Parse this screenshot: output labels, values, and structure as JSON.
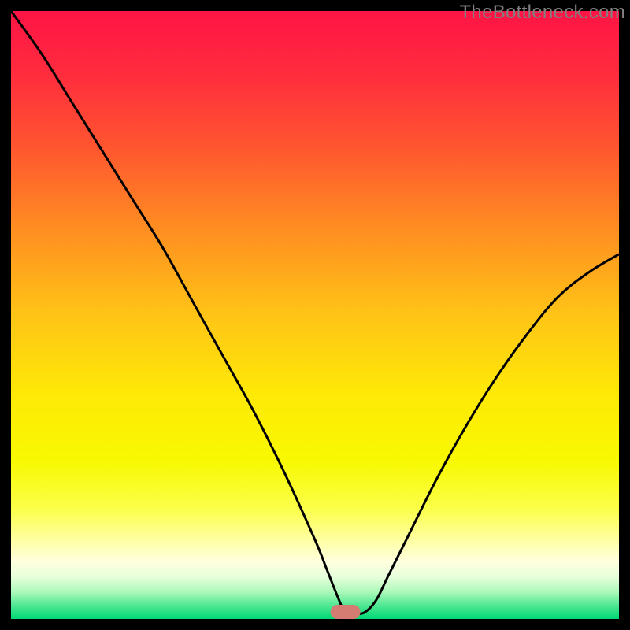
{
  "watermark": "TheBottleneck.com",
  "chart_data": {
    "type": "line",
    "title": "",
    "xlabel": "",
    "ylabel": "",
    "xlim": [
      0,
      100
    ],
    "ylim": [
      0,
      100
    ],
    "grid": false,
    "legend": false,
    "background": {
      "type": "vertical-gradient",
      "stops": [
        {
          "offset": 0.0,
          "color": "#ff1445"
        },
        {
          "offset": 0.1,
          "color": "#ff2b3e"
        },
        {
          "offset": 0.22,
          "color": "#ff5430"
        },
        {
          "offset": 0.35,
          "color": "#ff8a22"
        },
        {
          "offset": 0.5,
          "color": "#ffc416"
        },
        {
          "offset": 0.63,
          "color": "#fee906"
        },
        {
          "offset": 0.74,
          "color": "#f8f901"
        },
        {
          "offset": 0.82,
          "color": "#fbff4b"
        },
        {
          "offset": 0.87,
          "color": "#feffa2"
        },
        {
          "offset": 0.905,
          "color": "#ffffde"
        },
        {
          "offset": 0.93,
          "color": "#e8ffdc"
        },
        {
          "offset": 0.955,
          "color": "#aef9bb"
        },
        {
          "offset": 0.978,
          "color": "#4ee792"
        },
        {
          "offset": 1.0,
          "color": "#00d876"
        }
      ]
    },
    "series": [
      {
        "name": "bottleneck-curve",
        "color": "#000000",
        "x": [
          0,
          5,
          10,
          15,
          20,
          25,
          30,
          35,
          40,
          45,
          50,
          52,
          54,
          55,
          56,
          58,
          60,
          62,
          65,
          70,
          75,
          80,
          85,
          90,
          95,
          100
        ],
        "values": [
          100,
          93,
          85,
          77,
          69,
          61,
          52,
          43,
          34,
          24,
          13,
          8,
          3,
          1,
          1,
          1,
          3,
          7,
          13,
          23,
          32,
          40,
          47,
          53,
          57,
          60
        ]
      }
    ],
    "marker": {
      "name": "optimal-point",
      "x": 55,
      "y": 0,
      "color": "#d47b72",
      "shape": "rounded-rect"
    }
  }
}
